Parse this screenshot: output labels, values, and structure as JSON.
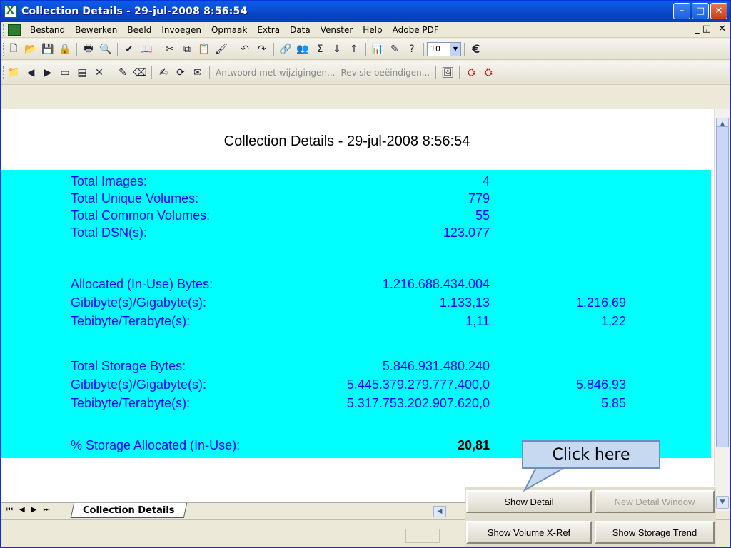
{
  "window": {
    "title": "Collection Details - 29-jul-2008 8:56:54",
    "controls": {
      "minimize": "–",
      "maximize": "□",
      "close": "✕"
    }
  },
  "menubar": {
    "items": [
      "Bestand",
      "Bewerken",
      "Beeld",
      "Invoegen",
      "Opmaak",
      "Extra",
      "Data",
      "Venster",
      "Help",
      "Adobe PDF"
    ],
    "right": {
      "restore": "_ ◱",
      "close": "✕"
    }
  },
  "toolbar": {
    "font_size": "10",
    "currency": "€",
    "sigma": "Σ"
  },
  "review_toolbar": {
    "reply": "Antwoord met wijzigingen...",
    "end_review": "Revisie beëindigen..."
  },
  "sheet": {
    "heading": "Collection Details - 29-jul-2008 8:56:54",
    "rows": [
      {
        "label": "Total Images:",
        "value": "4",
        "value2": ""
      },
      {
        "label": "Total Unique Volumes:",
        "value": "779",
        "value2": ""
      },
      {
        "label": "Total Common Volumes:",
        "value": "55",
        "value2": ""
      },
      {
        "label": "Total DSN(s):",
        "value": "123.077",
        "value2": ""
      },
      {
        "label": "Allocated (In-Use) Bytes:",
        "value": "1.216.688.434.004",
        "value2": ""
      },
      {
        "label": "Gibibyte(s)/Gigabyte(s):",
        "value": "1.133,13",
        "value2": "1.216,69"
      },
      {
        "label": "Tebibyte/Terabyte(s):",
        "value": "1,11",
        "value2": "1,22"
      },
      {
        "label": "Total Storage Bytes:",
        "value": "5.846.931.480.240",
        "value2": ""
      },
      {
        "label": "Gibibyte(s)/Gigabyte(s):",
        "value": "5.445.379.279.777.400,0",
        "value2": "5.846,93"
      },
      {
        "label": "Tebibyte/Terabyte(s):",
        "value": "5.317.753.202.907.620,0",
        "value2": "5,85"
      },
      {
        "label": "% Storage Allocated (In-Use):",
        "value": "20,81",
        "value2": ""
      }
    ]
  },
  "tabs": {
    "sheet_tab": "Collection Details",
    "nav": [
      "⏮",
      "◀",
      "▶",
      "⏭"
    ]
  },
  "buttons": {
    "show_detail": "Show Detail",
    "new_detail_window": "New Detail Window",
    "show_volume_xref": "Show Volume X-Ref",
    "show_storage_trend": "Show Storage Trend"
  },
  "callout": {
    "text": "Click here"
  },
  "colors": {
    "highlight": "#00ffff",
    "label_text": "#0000ff",
    "titlebar": "#0a4fd6"
  }
}
